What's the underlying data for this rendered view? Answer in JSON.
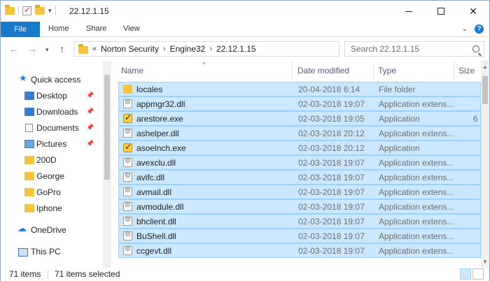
{
  "window": {
    "title": "22.12.1.15",
    "min_icon": "minimize-icon",
    "max_icon": "maximize-icon",
    "close_glyph": "✕"
  },
  "ribbon": {
    "tabs": [
      "File",
      "Home",
      "Share",
      "View"
    ]
  },
  "address": {
    "overflow": "«",
    "crumbs": [
      "Norton Security",
      "Engine32",
      "22.12.1.15"
    ],
    "search_placeholder": "Search 22.12.1.15"
  },
  "nav": {
    "items": [
      {
        "label": "Quick access",
        "icon": "star-icon",
        "pinned": false
      },
      {
        "label": "Desktop",
        "icon": "desktop-folder-icon",
        "pinned": true
      },
      {
        "label": "Downloads",
        "icon": "downloads-folder-icon",
        "pinned": true
      },
      {
        "label": "Documents",
        "icon": "documents-folder-icon",
        "pinned": true
      },
      {
        "label": "Pictures",
        "icon": "pictures-folder-icon",
        "pinned": true
      },
      {
        "label": "200D",
        "icon": "folder-icon",
        "pinned": false
      },
      {
        "label": "George",
        "icon": "folder-icon",
        "pinned": false
      },
      {
        "label": "GoPro",
        "icon": "folder-icon",
        "pinned": false
      },
      {
        "label": "Iphone",
        "icon": "folder-icon",
        "pinned": false
      },
      {
        "label": "OneDrive",
        "icon": "cloud-icon",
        "pinned": false
      },
      {
        "label": "This PC",
        "icon": "computer-icon",
        "pinned": false
      }
    ]
  },
  "columns": {
    "name": "Name",
    "date": "Date modified",
    "type": "Type",
    "size": "Size"
  },
  "files": [
    {
      "name": "locales",
      "date": "20-04-2018 6:14",
      "type": "File folder",
      "size": "",
      "icon": "folder-icon"
    },
    {
      "name": "appmgr32.dll",
      "date": "02-03-2018 19:07",
      "type": "Application extens...",
      "size": "",
      "icon": "dll-icon"
    },
    {
      "name": "arestore.exe",
      "date": "02-03-2018 19:05",
      "type": "Application",
      "size": "6",
      "icon": "exe-icon"
    },
    {
      "name": "ashelper.dll",
      "date": "02-03-2018 20:12",
      "type": "Application extens...",
      "size": "",
      "icon": "dll-icon"
    },
    {
      "name": "asoelnch.exe",
      "date": "02-03-2018 20:12",
      "type": "Application",
      "size": "",
      "icon": "exe-icon"
    },
    {
      "name": "avexclu.dll",
      "date": "02-03-2018 19:07",
      "type": "Application extens...",
      "size": "",
      "icon": "dll-icon"
    },
    {
      "name": "avifc.dll",
      "date": "02-03-2018 19:07",
      "type": "Application extens...",
      "size": "",
      "icon": "dll-icon"
    },
    {
      "name": "avmail.dll",
      "date": "02-03-2018 19:07",
      "type": "Application extens...",
      "size": "",
      "icon": "dll-icon"
    },
    {
      "name": "avmodule.dll",
      "date": "02-03-2018 19:07",
      "type": "Application extens...",
      "size": "",
      "icon": "dll-icon"
    },
    {
      "name": "bhclient.dll",
      "date": "02-03-2018 19:07",
      "type": "Application extens...",
      "size": "",
      "icon": "dll-icon"
    },
    {
      "name": "BuShell.dll",
      "date": "02-03-2018 19:07",
      "type": "Application extens...",
      "size": "",
      "icon": "dll-icon"
    },
    {
      "name": "ccgevt.dll",
      "date": "02-03-2018 19:07",
      "type": "Application extens...",
      "size": "",
      "icon": "dll-icon"
    }
  ],
  "status": {
    "count": "71 items",
    "selected": "71 items selected"
  },
  "colors": {
    "selection_bg": "#cce8ff",
    "selection_border": "#99d1ff",
    "file_tab": "#1979ca"
  }
}
